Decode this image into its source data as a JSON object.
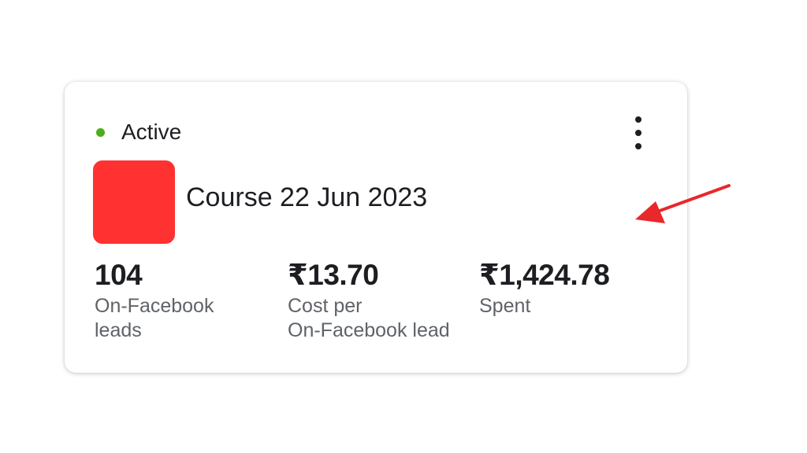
{
  "card": {
    "status": {
      "label": "Active",
      "color": "#4caf1a"
    },
    "menu_icon": "more-vertical-icon",
    "thumbnail_color": "#ff3131",
    "title": "Course 22 Jun 2023",
    "metrics": [
      {
        "value": "104",
        "label_line1": "On-Facebook",
        "label_line2": "leads"
      },
      {
        "value": "₹13.70",
        "label_line1": "Cost per",
        "label_line2": "On-Facebook lead"
      },
      {
        "value": "₹1,424.78",
        "label_line1": "Spent",
        "label_line2": ""
      }
    ]
  },
  "annotation": {
    "arrow_color": "#e8282b"
  }
}
